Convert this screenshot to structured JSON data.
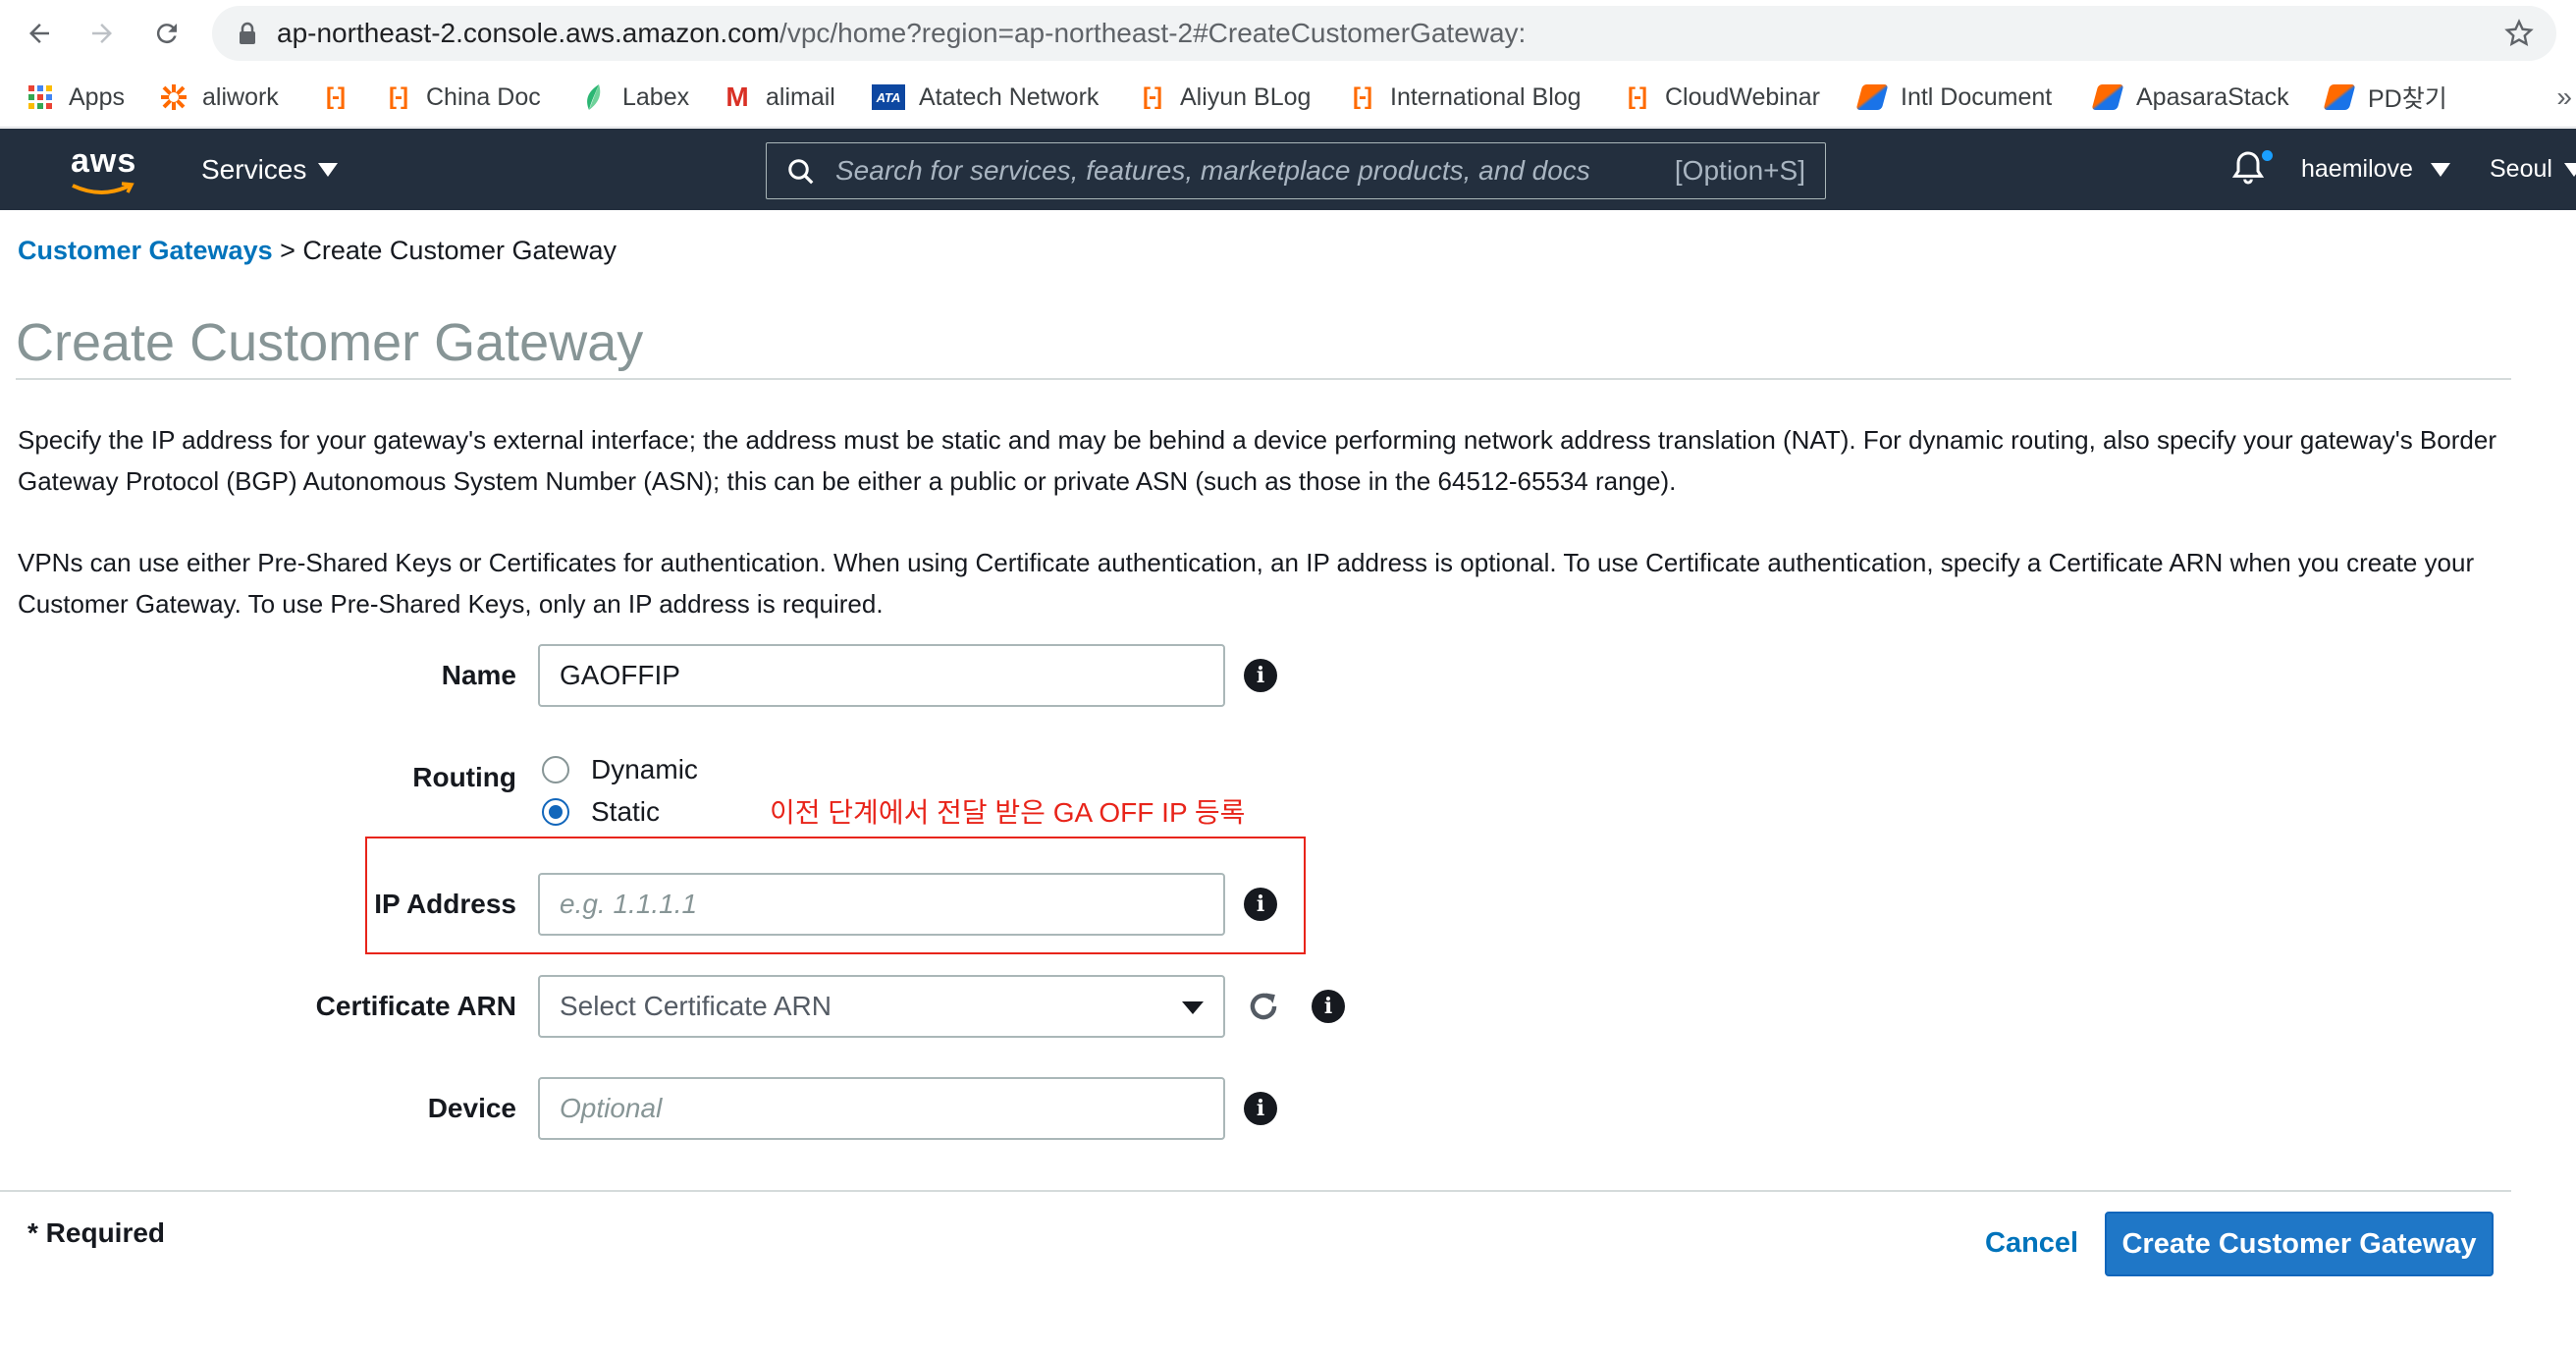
{
  "browser": {
    "url_host": "ap-northeast-2.console.aws.amazon.com",
    "url_path": "/vpc/home?region=ap-northeast-2#CreateCustomerGateway:",
    "bookmarks": [
      "Apps",
      "aliwork",
      "China Doc",
      "Labex",
      "alimail",
      "Atatech Network",
      "Aliyun BLog",
      "International Blog",
      "CloudWebinar",
      "Intl Document",
      "ApasaraStack",
      "PD찾기"
    ],
    "more": "»"
  },
  "aws_header": {
    "logo": "aws",
    "services": "Services",
    "search_placeholder": "Search for services, features, marketplace products, and docs",
    "search_shortcut": "[Option+S]",
    "user": "haemilove",
    "region": "Seoul"
  },
  "breadcrumb": {
    "parent": "Customer Gateways",
    "separator": " > ",
    "current": "Create Customer Gateway"
  },
  "page_title": "Create Customer Gateway",
  "description_1": "Specify the IP address for your gateway's external interface; the address must be static and may be behind a device performing network address translation (NAT). For dynamic routing, also specify your gateway's Border Gateway Protocol (BGP) Autonomous System Number (ASN); this can be either a public or private ASN (such as those in the 64512-65534 range).",
  "description_2": "VPNs can use either Pre-Shared Keys or Certificates for authentication. When using Certificate authentication, an IP address is optional. To use Certificate authentication, specify a Certificate ARN when you create your Customer Gateway. To use Pre-Shared Keys, only an IP address is required.",
  "form": {
    "name_label": "Name",
    "name_value": "GAOFFIP",
    "routing_label": "Routing",
    "routing_options": [
      "Dynamic",
      "Static"
    ],
    "routing_selected": "Static",
    "ip_label": "IP Address",
    "ip_placeholder": "e.g. 1.1.1.1",
    "cert_label": "Certificate ARN",
    "cert_value": "Select Certificate ARN",
    "device_label": "Device",
    "device_placeholder": "Optional",
    "info_glyph": "i"
  },
  "annotation": "이전 단계에서 전달 받은 GA OFF IP 등록",
  "footer": {
    "required": "* Required",
    "cancel": "Cancel",
    "create": "Create Customer Gateway"
  },
  "colors": {
    "aws_header_bg": "#232f3e",
    "link_blue": "#0073bb",
    "primary_button": "#1f77c7",
    "annotation_red": "#e8241a"
  }
}
